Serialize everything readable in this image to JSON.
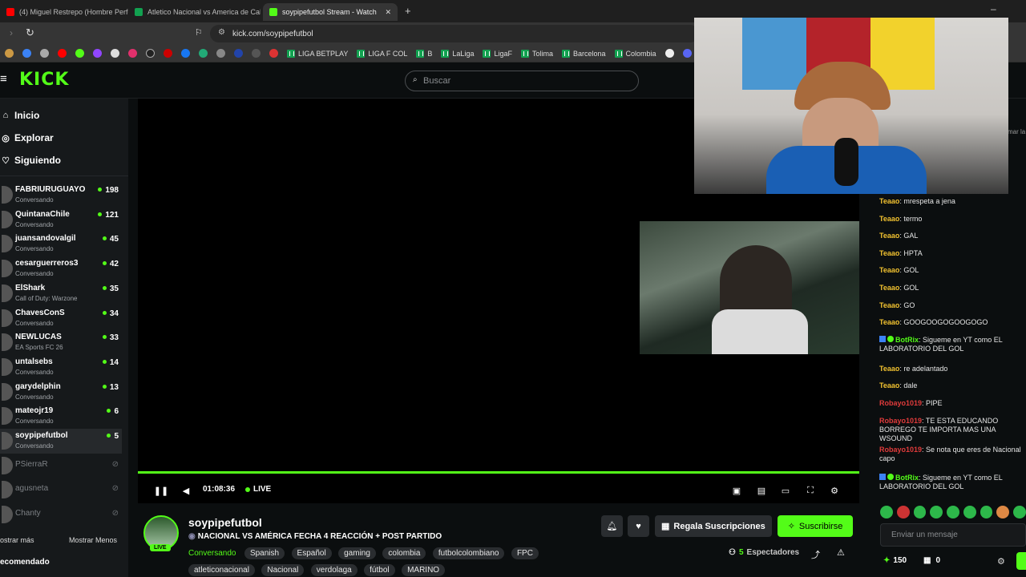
{
  "tabs": [
    {
      "title": "(4) Miguel Restrepo (Hombre Perfor",
      "active": false
    },
    {
      "title": "Atletico Nacional vs America de Cali",
      "active": false
    },
    {
      "title": "soypipefutbol Stream - Watch",
      "active": true
    }
  ],
  "url": "kick.com/soypipefutbol",
  "bookmarks": [
    "LIGA BETPLAY",
    "LIGA F COL",
    "B",
    "LaLiga",
    "LigaF",
    "Tolima",
    "Barcelona",
    "Colombia"
  ],
  "brand": {
    "logo": "KICK",
    "accent": "#53fc18"
  },
  "search": {
    "placeholder": "Buscar"
  },
  "nav": [
    {
      "label": "Inicio",
      "icon": "home-icon"
    },
    {
      "label": "Explorar",
      "icon": "compass-icon"
    },
    {
      "label": "Siguiendo",
      "icon": "heart-icon"
    }
  ],
  "following": [
    {
      "name": "FABRIURUGUAYO",
      "category": "Conversando",
      "viewers": "198",
      "live": true
    },
    {
      "name": "QuintanaChile",
      "category": "Conversando",
      "viewers": "121",
      "live": true
    },
    {
      "name": "juansandovalgil",
      "category": "Conversando",
      "viewers": "45",
      "live": true
    },
    {
      "name": "cesarguerreros3",
      "category": "Conversando",
      "viewers": "42",
      "live": true
    },
    {
      "name": "ElShark",
      "category": "Call of Duty: Warzone",
      "viewers": "35",
      "live": true
    },
    {
      "name": "ChavesConS",
      "category": "Conversando",
      "viewers": "34",
      "live": true
    },
    {
      "name": "NEWLUCAS",
      "category": "EA Sports FC 26",
      "viewers": "33",
      "live": true
    },
    {
      "name": "untalsebs",
      "category": "Conversando",
      "viewers": "14",
      "live": true
    },
    {
      "name": "garydelphin",
      "category": "Conversando",
      "viewers": "13",
      "live": true
    },
    {
      "name": "mateojr19",
      "category": "Conversando",
      "viewers": "6",
      "live": true
    },
    {
      "name": "soypipefutbol",
      "category": "Conversando",
      "viewers": "5",
      "live": true
    },
    {
      "name": "PSierraR",
      "category": "",
      "viewers": "",
      "live": false
    },
    {
      "name": "agusneta",
      "category": "",
      "viewers": "",
      "live": false
    },
    {
      "name": "Chanty",
      "category": "",
      "viewers": "",
      "live": false
    }
  ],
  "sidebar_footer": {
    "show_more": "ostrar más",
    "show_less": "Mostrar Menos",
    "recommended": "ecomendado"
  },
  "player": {
    "time": "01:08:36",
    "live_label": "LIVE",
    "progress": 1.0
  },
  "stream": {
    "channel": "soypipefutbol",
    "title": "NACIONAL VS AMÉRICA FECHA 4 REACCIÓN + POST PARTIDO",
    "category": "Conversando",
    "tags": [
      "Spanish",
      "Español",
      "gaming",
      "colombia",
      "futbolcolombiano",
      "FPC",
      "atleticonacional",
      "Nacional",
      "verdolaga",
      "fútbol",
      "MARINO"
    ],
    "live_badge": "LIVE",
    "gift_label": "Regala Suscripciones",
    "subscribe_label": "Suscribirse",
    "viewers": "5",
    "viewers_label": "Espectadores"
  },
  "chat": {
    "messages": [
      {
        "user": "Teaao",
        "text": "mrespeta a jena",
        "color": "#f2c230"
      },
      {
        "user": "Teaao",
        "text": "termo",
        "color": "#f2c230"
      },
      {
        "user": "Teaao",
        "text": "GAL",
        "color": "#f2c230"
      },
      {
        "user": "Teaao",
        "text": "HPTA",
        "color": "#f2c230"
      },
      {
        "user": "Teaao",
        "text": "GOL",
        "color": "#f2c230"
      },
      {
        "user": "Teaao",
        "text": "GOL",
        "color": "#f2c230"
      },
      {
        "user": "Teaao",
        "text": "GO",
        "color": "#f2c230"
      },
      {
        "user": "Teaao",
        "text": "GOOGOOGOGOOGOGO",
        "color": "#f2c230"
      },
      {
        "user": "BotRix",
        "text": "Sigueme en YT como EL LABORATORIO DEL GOL",
        "color": "#53fc18"
      },
      {
        "user": "Teaao",
        "text": "re adelantado",
        "color": "#f2c230"
      },
      {
        "user": "Teaao",
        "text": "dale",
        "color": "#f2c230"
      },
      {
        "user": "Robayo1019",
        "text": "PIPE",
        "color": "#e03b3b"
      },
      {
        "user": "Robayo1019",
        "text": "TE ESTA EDUCANDO BORREGO TE IMPORTA MAS UNA WSOUND",
        "color": "#e03b3b"
      },
      {
        "user": "Robayo1019",
        "text": "Se nota que eres de Nacional capo",
        "color": "#e03b3b"
      },
      {
        "user": "BotRix",
        "text": "Sigueme en YT como EL LABORATORIO DEL GOL",
        "color": "#53fc18"
      }
    ],
    "input_placeholder": "Enviar un mensaje",
    "points": "150",
    "gifts": "0",
    "partial_label": "mar la"
  }
}
